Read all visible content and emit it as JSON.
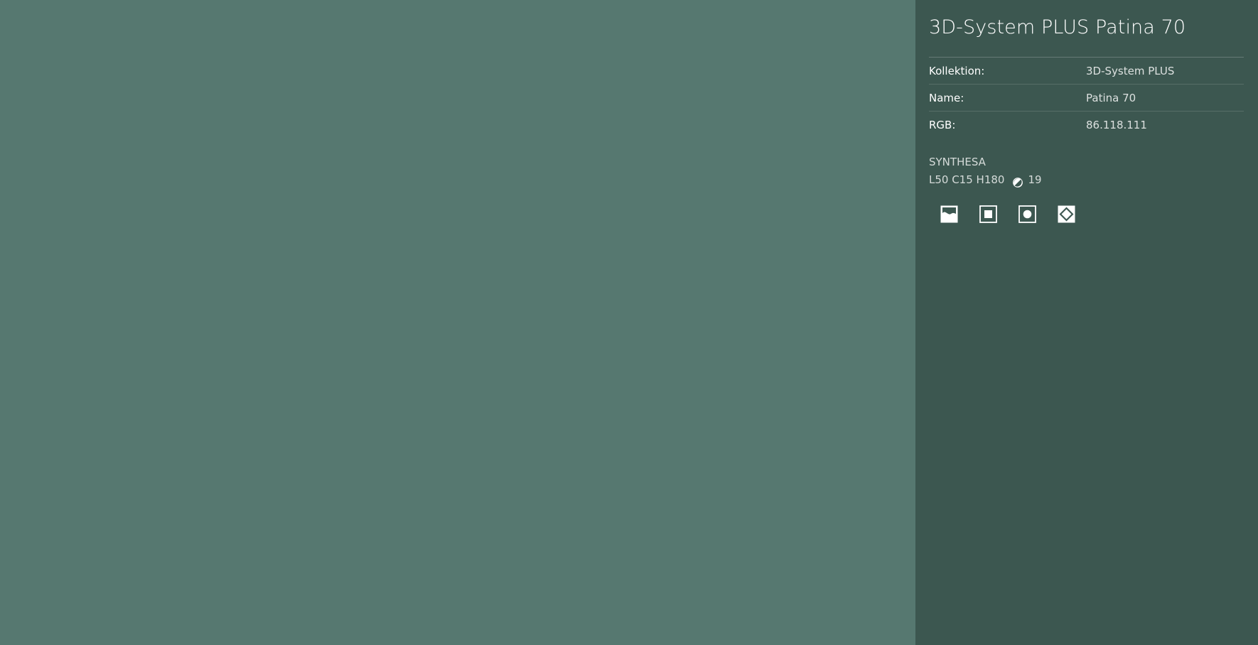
{
  "colors": {
    "swatch": "#567870",
    "panel": "#3c5750"
  },
  "title": "3D-System PLUS Patina 70",
  "properties": [
    {
      "label": "Kollektion:",
      "value": "3D-System PLUS"
    },
    {
      "label": "Name:",
      "value": "Patina 70"
    },
    {
      "label": "RGB:",
      "value": "86.118.111"
    }
  ],
  "synthesa": {
    "system": "SYNTHESA",
    "lch": "L50 C15 H180",
    "contrast_icon": "contrast-half-circle-icon",
    "contrast_value": "19"
  },
  "view_icons": [
    {
      "name": "landscape-view-icon"
    },
    {
      "name": "square-view-icon"
    },
    {
      "name": "circle-view-icon"
    },
    {
      "name": "diamond-view-icon"
    }
  ]
}
